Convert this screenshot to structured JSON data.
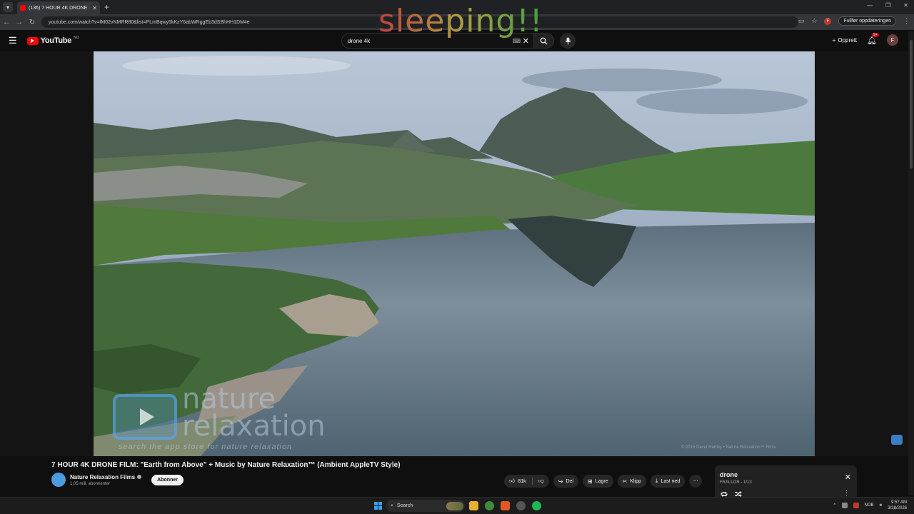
{
  "browser": {
    "tab_title": "(136) 7 HOUR 4K DRONE FILM: \"Earth from Above\"",
    "url": "youtube.com/watch?v=lM02vNMRR80&list=PLmBqwy5kKzY6abWRggEb3dSBhHH1DM4e",
    "update_button": "Fullfør oppdateringen",
    "profile_initial": "F"
  },
  "overlay": {
    "text": "sleeping!!"
  },
  "youtube": {
    "logo": "YouTube",
    "country_code": "NO",
    "search_value": "drone 4k",
    "create_label": "Opprett",
    "notif_badge": "9+",
    "avatar_initial": "F"
  },
  "video": {
    "watermark_line1": "nature",
    "watermark_line2": "relaxation",
    "watermark_tagline": "search the app store for nature relaxation",
    "copyright": "© 2016 David Hartley • Nature Relaxation™ Films",
    "title": "7 HOUR 4K DRONE FILM: \"Earth from Above\" + Music by Nature Relaxation™ (Ambient AppleTV Style)",
    "channel_name": "Nature Relaxation Films",
    "subscribers": "1,05 mill. abonnenter",
    "subscribe_label": "Abonner",
    "likes": "81k",
    "share_label": "Del",
    "save_label": "Lagre",
    "clip_label": "Klipp",
    "download_label": "Last ned"
  },
  "miniplayer": {
    "title": "drone",
    "subtitle": "FRALLOR - 1/13"
  },
  "taskbar": {
    "search_label": "Search",
    "lang": "NOB",
    "time": "9:57 AM",
    "date": "3/28/2026"
  }
}
